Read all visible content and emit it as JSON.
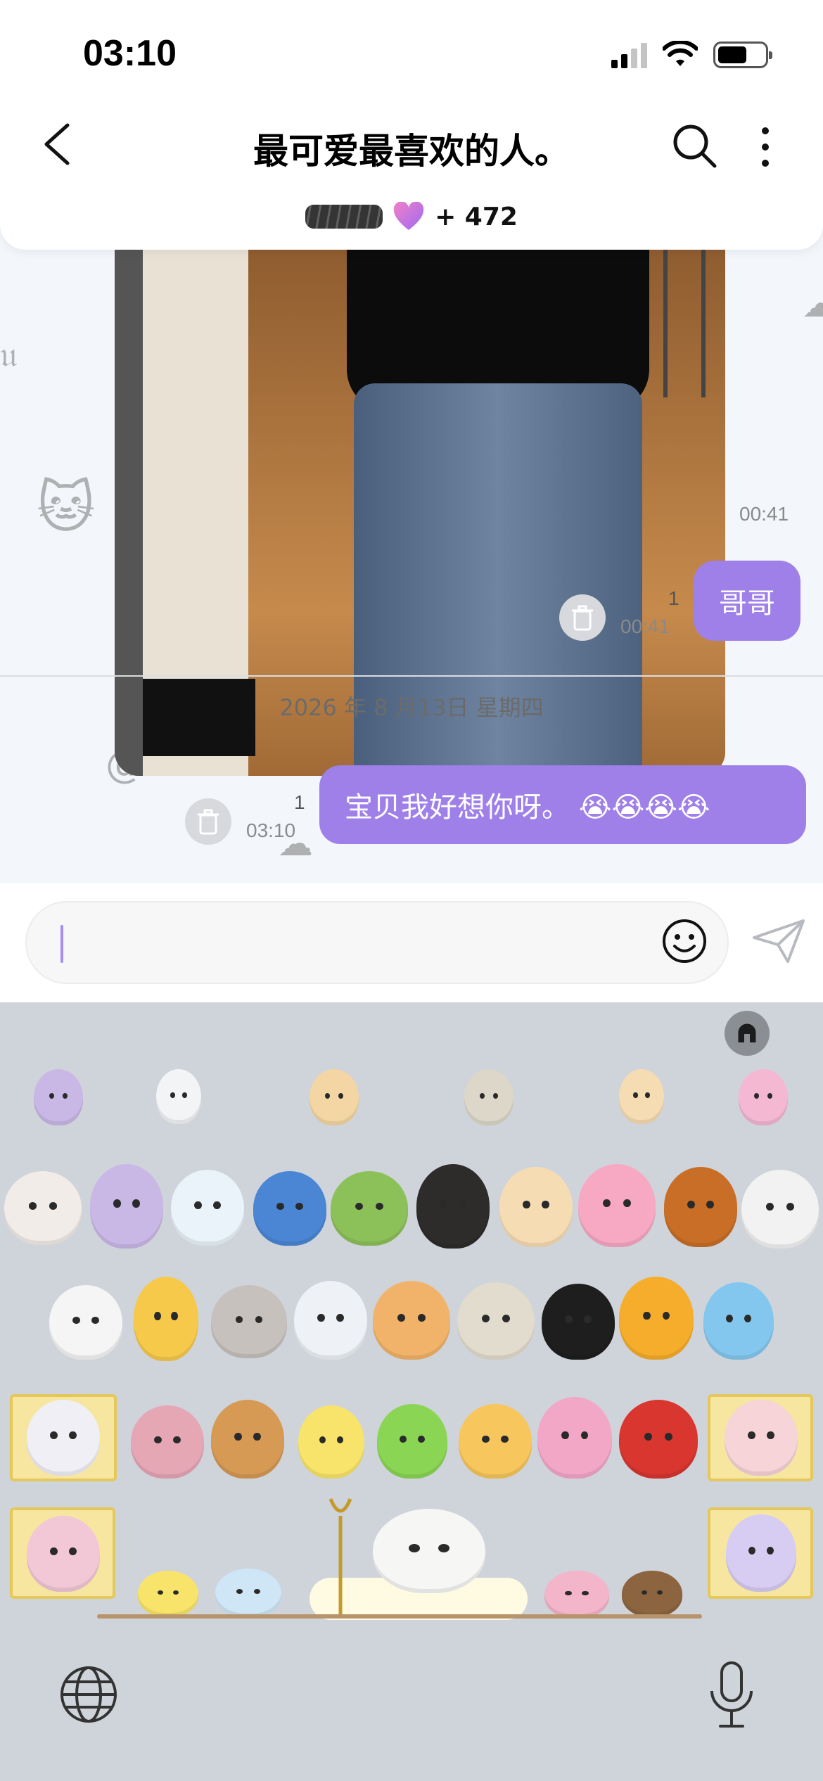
{
  "status_bar": {
    "time": "03:10"
  },
  "header": {
    "title": "最可爱最喜欢的人。",
    "member_count": "+ 472"
  },
  "messages": [
    {
      "type": "photo",
      "time": "00:41"
    },
    {
      "type": "text",
      "text": "哥哥",
      "read_count": "1",
      "time": "00:41"
    },
    {
      "type": "date",
      "text": "2026 年 8 月13日 星期四"
    },
    {
      "type": "text",
      "text": "宝贝我好想你呀。 😭😭😭😭",
      "read_count": "1",
      "time": "03:10"
    }
  ],
  "input": {
    "placeholder": ""
  },
  "colors": {
    "accent": "#9f7fe8",
    "keyboard_bg": "#cfd3da"
  },
  "icons": [
    "back-icon",
    "search-icon",
    "more-icon",
    "heart-icon",
    "trash-icon",
    "emoji-icon",
    "send-icon",
    "keyboard-toggle-icon",
    "globe-icon",
    "mic-icon"
  ]
}
